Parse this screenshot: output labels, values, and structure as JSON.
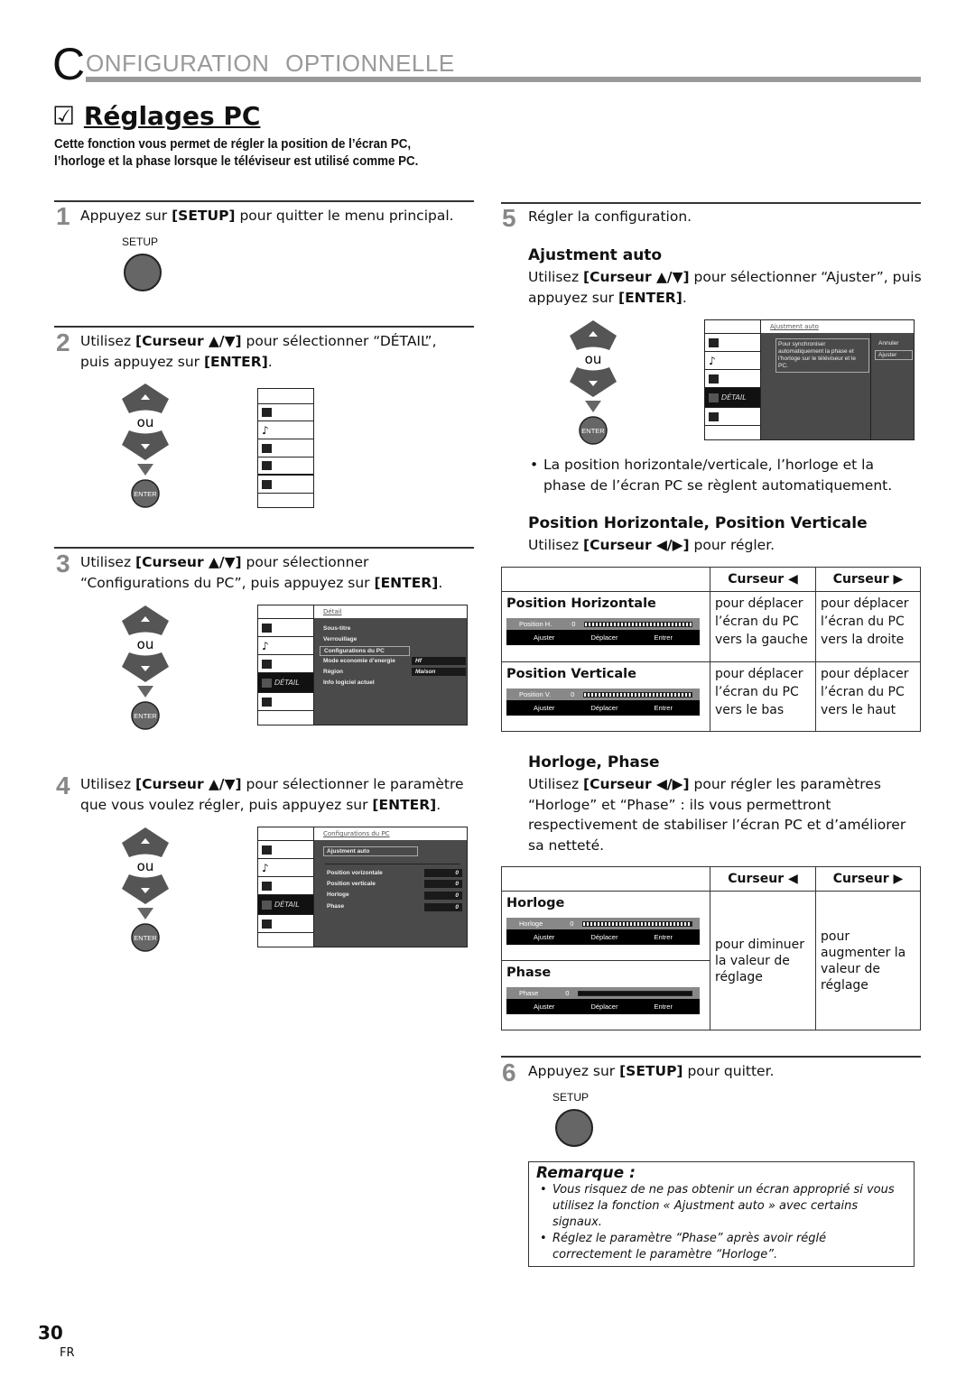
{
  "header": {
    "initial": "C",
    "rest": "ONFIGURATION  OPTIONNELLE"
  },
  "section": {
    "checkbox": "☑",
    "title": "Réglages PC",
    "intro": "Cette fonction vous permet de régler la position de l’écran PC, l’horloge et la phase lorsque le téléviseur est utilisé comme PC."
  },
  "remote": {
    "or": "ou",
    "enter": "ENTER",
    "setup": "SETUP"
  },
  "steps": [
    {
      "n": "1",
      "pre": "Appuyez sur ",
      "key": "[SETUP]",
      "post": " pour quitter le menu principal."
    },
    {
      "n": "2",
      "pre": "Utilisez ",
      "key": "[Curseur ▲/▼]",
      "post": " pour sélectionner “DÉTAIL”, puis appuyez sur ",
      "key2": "[ENTER]",
      "end": "."
    },
    {
      "n": "3",
      "pre": "Utilisez ",
      "key": "[Curseur ▲/▼]",
      "post": " pour sélectionner “Configurations du PC”, puis appuyez sur ",
      "key2": "[ENTER]",
      "end": "."
    },
    {
      "n": "4",
      "pre": "Utilisez ",
      "key": "[Curseur ▲/▼]",
      "post": " pour sélectionner le paramètre que vous voulez régler, puis appuyez sur ",
      "key2": "[ENTER]",
      "end": "."
    },
    {
      "n": "5",
      "text": "Régler la configuration."
    },
    {
      "n": "6",
      "pre": "Appuyez sur ",
      "key": "[SETUP]",
      "post": " pour quitter."
    }
  ],
  "menus": {
    "detail_label": "DÉTAIL",
    "detail": {
      "title": "Détail",
      "items": [
        "Sous-titre",
        "Verrouillage",
        "Configurations du PC",
        "Mode economie d’energie",
        "Région",
        "Info logiciel actuel"
      ],
      "values": [
        "Hf",
        "Maison"
      ]
    },
    "pc": {
      "title": "Configurations du PC",
      "auto": "Ajustment auto",
      "items": [
        "Position vorizontale",
        "Position verticale",
        "Horloge",
        "Phase"
      ],
      "values": [
        "0",
        "0",
        "0",
        "0"
      ]
    },
    "auto": {
      "title": "Ajustment auto",
      "desc": "Pour synchroniser automatiquement la phase et l’horloge sur le téléviseur et le PC.",
      "cancel": "Annuler",
      "adjust": "Ajuster"
    }
  },
  "auto_section": {
    "heading": "Ajustment auto",
    "pre": "Utilisez ",
    "key": "[Curseur ▲/▼]",
    "post": " pour sélectionner “Ajuster”, puis appuyez sur ",
    "key2": "[ENTER]",
    "end": ".",
    "bullet": "La position horizontale/verticale, l’horloge et la phase de l’écran PC se règlent automatiquement."
  },
  "pos_section": {
    "heading": "Position Horizontale, Position Verticale",
    "pre": "Utilisez ",
    "key": "[Curseur ◀/▶]",
    "post": " pour régler."
  },
  "osd": {
    "adjust": "Ajuster",
    "move": "Déplacer",
    "enter": "Entrer",
    "zero": "0"
  },
  "table1": {
    "col_left": "Curseur ◀",
    "col_right": "Curseur ▶",
    "rows": [
      {
        "label": "Position Horizontale",
        "osd": "Position H.",
        "left": "pour déplacer l’écran du PC vers la gauche",
        "right": "pour déplacer l’écran du PC vers la droite"
      },
      {
        "label": "Position Verticale",
        "osd": "Position V.",
        "left": "pour déplacer l’écran du PC vers le bas",
        "right": "pour déplacer l’écran du PC vers le haut"
      }
    ]
  },
  "clock_section": {
    "heading": "Horloge, Phase",
    "pre": "Utilisez ",
    "key": "[Curseur ◀/▶]",
    "post": " pour régler les paramètres “Horloge” et “Phase” : ils vous permettront respectivement de stabiliser l’écran PC et d’améliorer sa netteté."
  },
  "table2": {
    "col_left": "Curseur ◀",
    "col_right": "Curseur ▶",
    "rows": [
      {
        "label": "Horloge",
        "osd": "Horloge"
      },
      {
        "label": "Phase",
        "osd": "Phase"
      }
    ],
    "left": "pour diminuer la valeur de réglage",
    "right": "pour augmenter la valeur de réglage"
  },
  "remarque": {
    "title": "Remarque :",
    "items": [
      "Vous risquez de ne pas obtenir un écran approprié si vous utilisez la fonction « Ajustment auto » avec certains signaux.",
      "Réglez le paramètre “Phase” après avoir réglé correctement le paramètre “Horloge”."
    ]
  },
  "footer": {
    "page": "30",
    "lang": "FR"
  }
}
